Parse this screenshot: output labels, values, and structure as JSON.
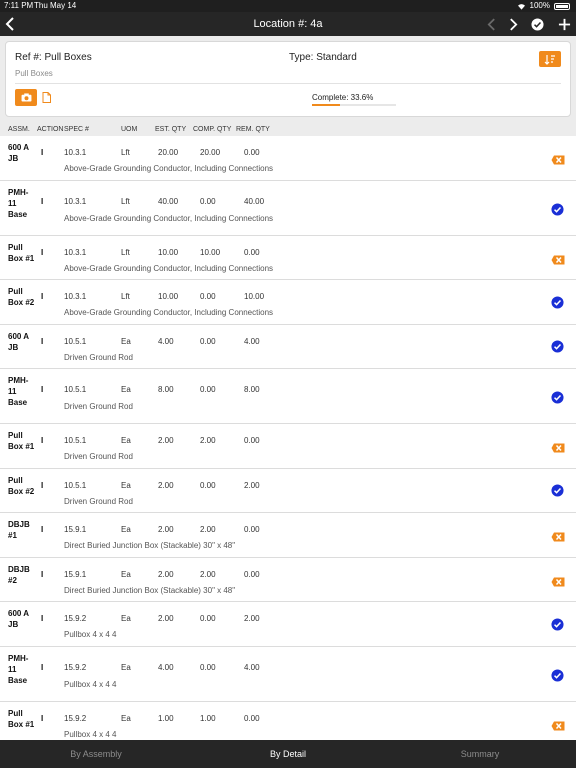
{
  "status_bar": {
    "time": "7:11 PM",
    "date": "Thu May 14",
    "battery": "100%"
  },
  "nav": {
    "title": "Location #: 4a"
  },
  "card": {
    "ref": "Ref #: Pull Boxes",
    "type": "Type: Standard",
    "subname": "Pull Boxes",
    "complete_label": "Complete: 33.6%",
    "progress": 0.336
  },
  "columns": [
    "ASSM.",
    "ACTION",
    "SPEC #",
    "UOM",
    "EST. QTY",
    "COMP. QTY",
    "REM. QTY"
  ],
  "rows": [
    {
      "assm": "600 A\nJB",
      "action": "I",
      "spec": "10.3.1",
      "uom": "Lft",
      "est": "20.00",
      "comp": "20.00",
      "rem": "0.00",
      "desc": "Above-Grade Grounding Conductor, Including Connections",
      "status": "incomplete"
    },
    {
      "assm": "PMH-\n11\nBase",
      "action": "I",
      "spec": "10.3.1",
      "uom": "Lft",
      "est": "40.00",
      "comp": "0.00",
      "rem": "40.00",
      "desc": "Above-Grade Grounding Conductor, Including Connections",
      "status": "complete"
    },
    {
      "assm": "Pull\nBox #1",
      "action": "I",
      "spec": "10.3.1",
      "uom": "Lft",
      "est": "10.00",
      "comp": "10.00",
      "rem": "0.00",
      "desc": "Above-Grade Grounding Conductor, Including Connections",
      "status": "incomplete"
    },
    {
      "assm": "Pull\nBox #2",
      "action": "I",
      "spec": "10.3.1",
      "uom": "Lft",
      "est": "10.00",
      "comp": "0.00",
      "rem": "10.00",
      "desc": "Above-Grade Grounding Conductor, Including Connections",
      "status": "complete"
    },
    {
      "assm": "600 A\nJB",
      "action": "I",
      "spec": "10.5.1",
      "uom": "Ea",
      "est": "4.00",
      "comp": "0.00",
      "rem": "4.00",
      "desc": "Driven Ground Rod",
      "status": "complete"
    },
    {
      "assm": "PMH-\n11\nBase",
      "action": "I",
      "spec": "10.5.1",
      "uom": "Ea",
      "est": "8.00",
      "comp": "0.00",
      "rem": "8.00",
      "desc": "Driven Ground Rod",
      "status": "complete"
    },
    {
      "assm": "Pull\nBox #1",
      "action": "I",
      "spec": "10.5.1",
      "uom": "Ea",
      "est": "2.00",
      "comp": "2.00",
      "rem": "0.00",
      "desc": "Driven Ground Rod",
      "status": "incomplete"
    },
    {
      "assm": "Pull\nBox #2",
      "action": "I",
      "spec": "10.5.1",
      "uom": "Ea",
      "est": "2.00",
      "comp": "0.00",
      "rem": "2.00",
      "desc": "Driven Ground Rod",
      "status": "complete"
    },
    {
      "assm": "DBJB\n#1",
      "action": "I",
      "spec": "15.9.1",
      "uom": "Ea",
      "est": "2.00",
      "comp": "2.00",
      "rem": "0.00",
      "desc": "Direct Buried Junction Box (Stackable) 30\" x 48\"",
      "status": "incomplete"
    },
    {
      "assm": "DBJB\n#2",
      "action": "I",
      "spec": "15.9.1",
      "uom": "Ea",
      "est": "2.00",
      "comp": "2.00",
      "rem": "0.00",
      "desc": "Direct Buried Junction Box (Stackable) 30\" x 48\"",
      "status": "incomplete"
    },
    {
      "assm": "600 A\nJB",
      "action": "I",
      "spec": "15.9.2",
      "uom": "Ea",
      "est": "2.00",
      "comp": "0.00",
      "rem": "2.00",
      "desc": "Pullbox 4 x 4 4",
      "status": "complete"
    },
    {
      "assm": "PMH-\n11\nBase",
      "action": "I",
      "spec": "15.9.2",
      "uom": "Ea",
      "est": "4.00",
      "comp": "0.00",
      "rem": "4.00",
      "desc": "Pullbox 4 x 4 4",
      "status": "complete"
    },
    {
      "assm": "Pull\nBox #1",
      "action": "I",
      "spec": "15.9.2",
      "uom": "Ea",
      "est": "1.00",
      "comp": "1.00",
      "rem": "0.00",
      "desc": "Pullbox 4 x 4 4",
      "status": "incomplete"
    }
  ],
  "tabs": [
    {
      "label": "By Assembly",
      "active": false
    },
    {
      "label": "By Detail",
      "active": true
    },
    {
      "label": "Summary",
      "active": false
    }
  ],
  "icons": {
    "back": "chevron-left-icon",
    "prev": "chevron-left-icon",
    "next": "chevron-right-icon",
    "done": "check-circle-icon",
    "add": "plus-icon",
    "sort": "sort-icon",
    "camera": "camera-icon",
    "document": "document-icon",
    "row_complete": "check-circle-icon",
    "row_incomplete": "close-tag-icon"
  },
  "colors": {
    "accent": "#f08a1c",
    "check": "#1a2fd6",
    "bar": "#262626"
  }
}
